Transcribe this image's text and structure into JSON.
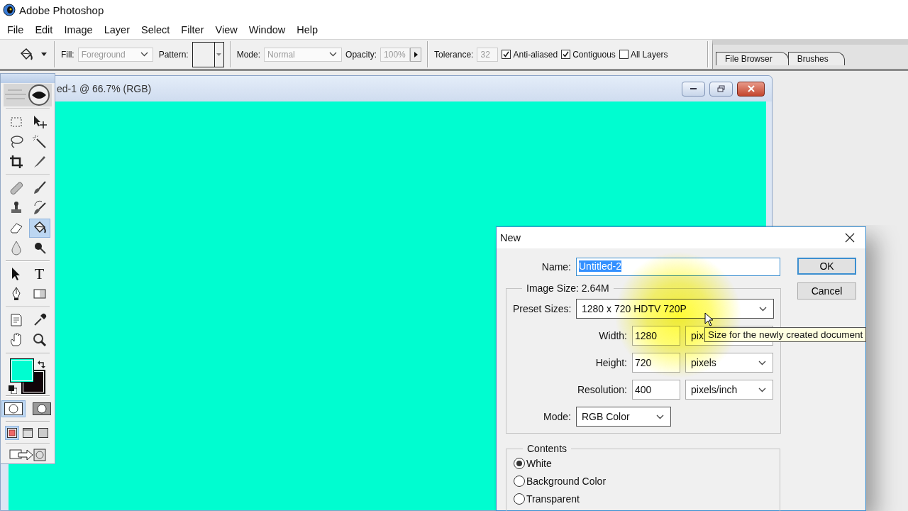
{
  "app": {
    "title": "Adobe Photoshop"
  },
  "menu": [
    "File",
    "Edit",
    "Image",
    "Layer",
    "Select",
    "Filter",
    "View",
    "Window",
    "Help"
  ],
  "options_bar": {
    "fill": {
      "label": "Fill:",
      "value": "Foreground",
      "disabled": true
    },
    "pattern": {
      "label": "Pattern:"
    },
    "mode": {
      "label": "Mode:",
      "value": "Normal",
      "disabled": true
    },
    "opacity": {
      "label": "Opacity:",
      "value": "100%",
      "disabled": true
    },
    "tolerance": {
      "label": "Tolerance:",
      "value": "32",
      "disabled": true
    },
    "checkboxes": [
      {
        "label": "Anti-aliased",
        "checked": true
      },
      {
        "label": "Contiguous",
        "checked": true
      },
      {
        "label": "All Layers",
        "checked": false
      }
    ],
    "palette_tabs": [
      {
        "label": "File Browser",
        "selected": false
      },
      {
        "label": "Brushes",
        "selected": false
      }
    ]
  },
  "document": {
    "title": "ed-1 @ 66.7% (RGB)"
  },
  "toolbox": {
    "tool_groups": [
      {
        "tools": [
          {
            "kind": "marquee",
            "selected": false
          },
          {
            "kind": "move",
            "selected": false
          },
          {
            "kind": "lasso",
            "selected": false
          },
          {
            "kind": "wand",
            "selected": false
          },
          {
            "kind": "crop",
            "selected": false
          },
          {
            "kind": "slice",
            "selected": false
          }
        ]
      },
      {
        "tools": [
          {
            "kind": "healing",
            "selected": false
          },
          {
            "kind": "brush",
            "selected": false
          },
          {
            "kind": "stamp",
            "selected": false
          },
          {
            "kind": "history",
            "selected": false
          },
          {
            "kind": "eraser",
            "selected": false
          },
          {
            "kind": "bucket",
            "selected": true
          },
          {
            "kind": "blur",
            "selected": false
          },
          {
            "kind": "dodge",
            "selected": false
          }
        ]
      },
      {
        "tools": [
          {
            "kind": "select",
            "selected": false
          },
          {
            "kind": "type",
            "glyph": "T",
            "selected": false
          },
          {
            "kind": "pen",
            "selected": false
          },
          {
            "kind": "gradient",
            "selected": false
          }
        ]
      },
      {
        "tools": [
          {
            "kind": "notes",
            "selected": false
          },
          {
            "kind": "eyedropper",
            "selected": false
          },
          {
            "kind": "hand",
            "selected": false
          },
          {
            "kind": "zoom",
            "selected": false
          }
        ]
      }
    ],
    "swatches": [
      {
        "kind": "foreground",
        "color": "#00fdd0"
      },
      {
        "kind": "background",
        "color": "#100408"
      }
    ],
    "mask_modes": [
      {
        "kind": "standard",
        "selected": true
      },
      {
        "kind": "quick",
        "selected": false
      }
    ],
    "screen_modes": [
      {
        "kind": "standard",
        "selected": true
      },
      {
        "kind": "menubar",
        "selected": false
      },
      {
        "kind": "full",
        "selected": false
      }
    ]
  },
  "dialog": {
    "title": "New",
    "name": {
      "label": "Name:",
      "value": "Untitled-2"
    },
    "image_size": {
      "label": "Image Size: 2.64M",
      "preset": {
        "label": "Preset Sizes:",
        "value": "1280 x 720 HDTV 720P"
      },
      "fields": [
        {
          "label": "Width:",
          "value": "1280",
          "unit": "pix",
          "covered_by_tooltip": true
        },
        {
          "label": "Height:",
          "value": "720",
          "unit": "pixels",
          "covered_by_tooltip": false
        },
        {
          "label": "Resolution:",
          "value": "400",
          "unit": "pixels/inch",
          "covered_by_tooltip": false
        }
      ],
      "mode": {
        "label": "Mode:",
        "value": "RGB Color"
      }
    },
    "tooltip": "Size for the newly created document",
    "contents": {
      "label": "Contents",
      "options": [
        {
          "label": "White",
          "selected": true
        },
        {
          "label": "Background Color",
          "selected": false
        },
        {
          "label": "Transparent",
          "selected": false
        }
      ]
    },
    "buttons": [
      {
        "label": "OK",
        "default": true
      },
      {
        "label": "Cancel",
        "default": false
      }
    ]
  }
}
